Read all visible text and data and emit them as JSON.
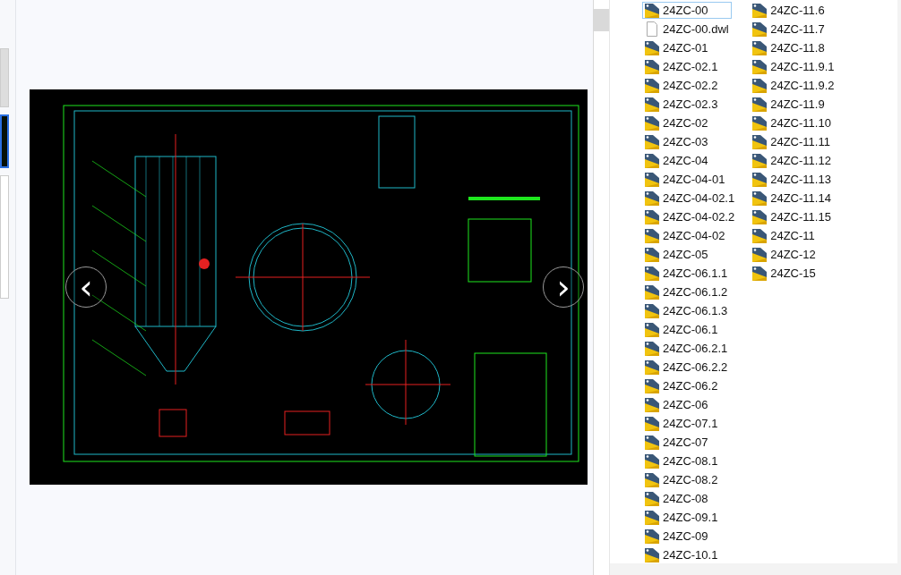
{
  "preview": {
    "prev_label": "‹",
    "next_label": "›"
  },
  "files": [
    {
      "name": "24ZC-00",
      "kind": "drawing",
      "selected": true
    },
    {
      "name": "24ZC-00.dwl",
      "kind": "file",
      "selected": false
    },
    {
      "name": "24ZC-01",
      "kind": "drawing",
      "selected": false
    },
    {
      "name": "24ZC-02.1",
      "kind": "drawing",
      "selected": false
    },
    {
      "name": "24ZC-02.2",
      "kind": "drawing",
      "selected": false
    },
    {
      "name": "24ZC-02.3",
      "kind": "drawing",
      "selected": false
    },
    {
      "name": "24ZC-02",
      "kind": "drawing",
      "selected": false
    },
    {
      "name": "24ZC-03",
      "kind": "drawing",
      "selected": false
    },
    {
      "name": "24ZC-04",
      "kind": "drawing",
      "selected": false
    },
    {
      "name": "24ZC-04-01",
      "kind": "drawing",
      "selected": false
    },
    {
      "name": "24ZC-04-02.1",
      "kind": "drawing",
      "selected": false
    },
    {
      "name": "24ZC-04-02.2",
      "kind": "drawing",
      "selected": false
    },
    {
      "name": "24ZC-04-02",
      "kind": "drawing",
      "selected": false
    },
    {
      "name": "24ZC-05",
      "kind": "drawing",
      "selected": false
    },
    {
      "name": "24ZC-06.1.1",
      "kind": "drawing",
      "selected": false
    },
    {
      "name": "24ZC-06.1.2",
      "kind": "drawing",
      "selected": false
    },
    {
      "name": "24ZC-06.1.3",
      "kind": "drawing",
      "selected": false
    },
    {
      "name": "24ZC-06.1",
      "kind": "drawing",
      "selected": false
    },
    {
      "name": "24ZC-06.2.1",
      "kind": "drawing",
      "selected": false
    },
    {
      "name": "24ZC-06.2.2",
      "kind": "drawing",
      "selected": false
    },
    {
      "name": "24ZC-06.2",
      "kind": "drawing",
      "selected": false
    },
    {
      "name": "24ZC-06",
      "kind": "drawing",
      "selected": false
    },
    {
      "name": "24ZC-07.1",
      "kind": "drawing",
      "selected": false
    },
    {
      "name": "24ZC-07",
      "kind": "drawing",
      "selected": false
    },
    {
      "name": "24ZC-08.1",
      "kind": "drawing",
      "selected": false
    },
    {
      "name": "24ZC-08.2",
      "kind": "drawing",
      "selected": false
    },
    {
      "name": "24ZC-08",
      "kind": "drawing",
      "selected": false
    },
    {
      "name": "24ZC-09.1",
      "kind": "drawing",
      "selected": false
    },
    {
      "name": "24ZC-09",
      "kind": "drawing",
      "selected": false
    },
    {
      "name": "24ZC-10.1",
      "kind": "drawing",
      "selected": false
    },
    {
      "name": "24ZC-11.6",
      "kind": "drawing",
      "selected": false
    },
    {
      "name": "24ZC-11.7",
      "kind": "drawing",
      "selected": false
    },
    {
      "name": "24ZC-11.8",
      "kind": "drawing",
      "selected": false
    },
    {
      "name": "24ZC-11.9.1",
      "kind": "drawing",
      "selected": false
    },
    {
      "name": "24ZC-11.9.2",
      "kind": "drawing",
      "selected": false
    },
    {
      "name": "24ZC-11.9",
      "kind": "drawing",
      "selected": false
    },
    {
      "name": "24ZC-11.10",
      "kind": "drawing",
      "selected": false
    },
    {
      "name": "24ZC-11.11",
      "kind": "drawing",
      "selected": false
    },
    {
      "name": "24ZC-11.12",
      "kind": "drawing",
      "selected": false
    },
    {
      "name": "24ZC-11.13",
      "kind": "drawing",
      "selected": false
    },
    {
      "name": "24ZC-11.14",
      "kind": "drawing",
      "selected": false
    },
    {
      "name": "24ZC-11.15",
      "kind": "drawing",
      "selected": false
    },
    {
      "name": "24ZC-11",
      "kind": "drawing",
      "selected": false
    },
    {
      "name": "24ZC-12",
      "kind": "drawing",
      "selected": false
    },
    {
      "name": "24ZC-15",
      "kind": "drawing",
      "selected": false
    }
  ]
}
